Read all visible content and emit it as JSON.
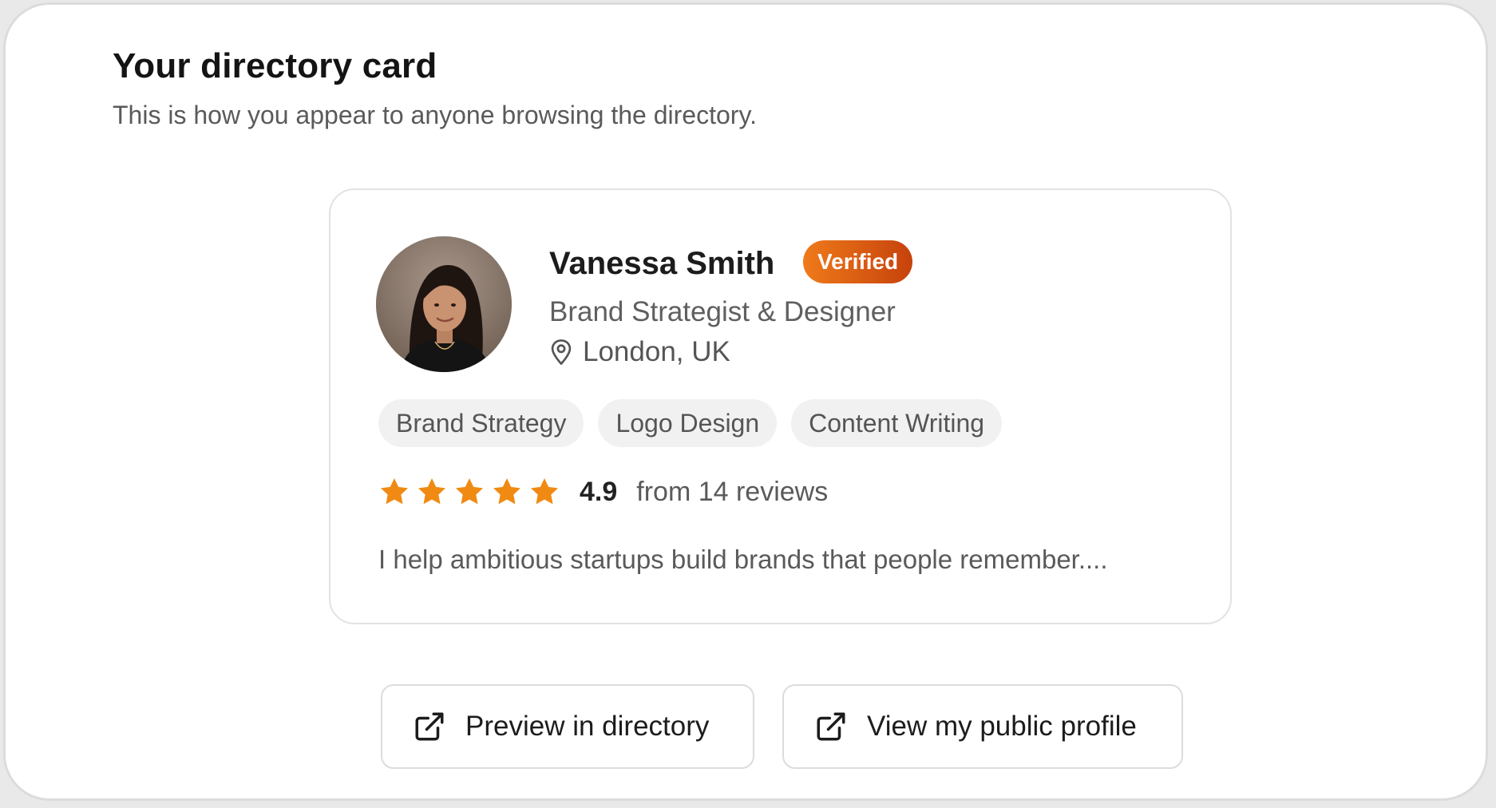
{
  "section": {
    "title": "Your directory card",
    "subtitle": "This is how you appear to anyone browsing the directory."
  },
  "profile": {
    "name": "Vanessa Smith",
    "badge": "Verified",
    "role": "Brand Strategist & Designer",
    "location": "London, UK",
    "avatar_alt": "Vanessa Smith",
    "tags": [
      "Brand Strategy",
      "Logo Design",
      "Content Writing"
    ],
    "rating": {
      "score": "4.9",
      "stars": 5,
      "reviews_text": "from 14 reviews"
    },
    "bio": "I help ambitious startups build brands that people remember...."
  },
  "actions": {
    "preview_label": "Preview in directory",
    "public_profile_label": "View my public profile"
  },
  "colors": {
    "accent_star": "#f08a12",
    "badge_start": "#ef7a1a",
    "badge_end": "#c6420c"
  },
  "icons": {
    "location": "map-pin-icon",
    "external": "external-link-icon",
    "star": "star-icon"
  }
}
